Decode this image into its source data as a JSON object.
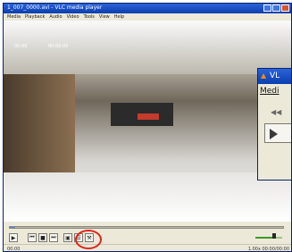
{
  "player": {
    "title": "1_007_0000.avi - VLC media player",
    "menu": [
      "Media",
      "Playback",
      "Audio",
      "Video",
      "Tools",
      "View",
      "Help"
    ],
    "osd_left": "00:00",
    "osd_right": "00:00:00",
    "seek_progress": 0.02,
    "controls": {
      "play": "▶",
      "prev": "⏮",
      "stop": "■",
      "next": "⏭",
      "fullscreen": "▣",
      "playlist": "☰",
      "extended": "⚒",
      "frame": "▤"
    },
    "volume_level": 0.7,
    "status_left": "00:00",
    "status_right": "1.00x  00:00/00:00"
  },
  "popup": {
    "title": "VL",
    "menu_label": "Medi",
    "prev_icon": "◀◀",
    "play_icon": "play-icon"
  },
  "annotation": {
    "circle_color": "#e0231b"
  }
}
